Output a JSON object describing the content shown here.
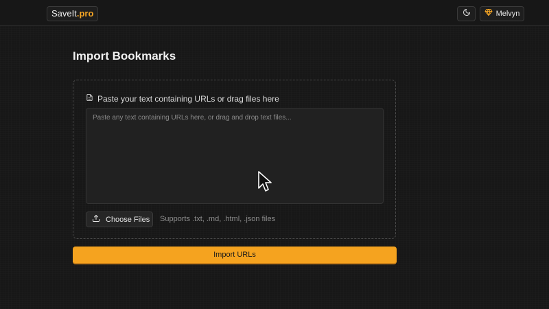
{
  "header": {
    "logo_main": "SaveIt",
    "logo_accent": ".pro",
    "theme_toggle_icon": "moon-icon",
    "user_icon": "diamond-icon",
    "user_name": "Melvyn",
    "accent_color": "#f5a524"
  },
  "main": {
    "title": "Import Bookmarks",
    "dropzone": {
      "icon": "document-icon",
      "label": "Paste your text containing URLs or drag files here",
      "textarea_placeholder": "Paste any text containing URLs here, or drag and drop text files...",
      "textarea_value": "",
      "choose_files_icon": "upload-icon",
      "choose_files_label": "Choose Files",
      "supports_text": "Supports .txt, .md, .html, .json files"
    },
    "import_button_label": "Import URLs",
    "import_button_color": "#f5a31f"
  }
}
